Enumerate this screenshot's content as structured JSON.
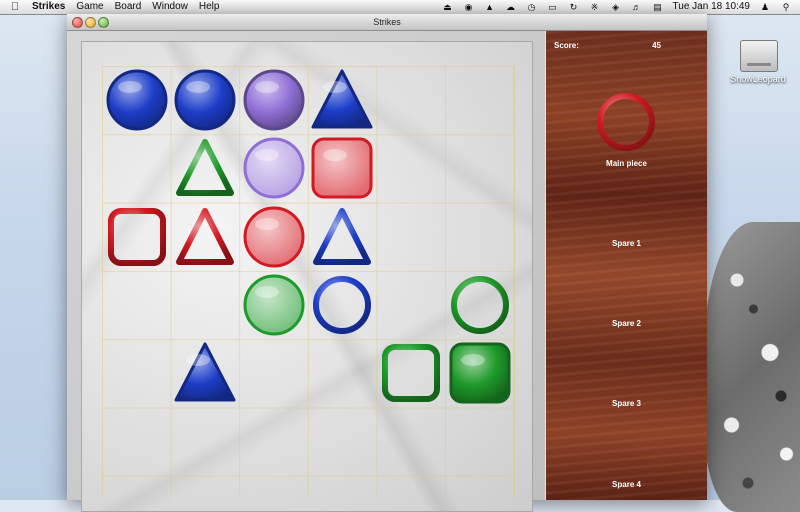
{
  "menubar": {
    "app_name": "Strikes",
    "items": [
      "Game",
      "Board",
      "Window",
      "Help"
    ],
    "clock": "Tue Jan 18  10:49"
  },
  "desktop": {
    "drive_label": "SnowLeopard"
  },
  "window": {
    "title": "Strikes"
  },
  "panel": {
    "score_label": "Score:",
    "score_value": "45",
    "main_piece_label": "Main piece",
    "spare_labels": [
      "Spare 1",
      "Spare 2",
      "Spare 3",
      "Spare 4"
    ]
  },
  "colors": {
    "red": "#d21a22",
    "green": "#1e9a2a",
    "blue": "#1d3ec9",
    "purple": "#8f6fd6"
  },
  "board": {
    "rows": 6,
    "cols": 6,
    "pieces": [
      {
        "row": 0,
        "col": 0,
        "shape": "circle",
        "style": "filled",
        "color": "blue"
      },
      {
        "row": 0,
        "col": 1,
        "shape": "circle",
        "style": "filled",
        "color": "blue"
      },
      {
        "row": 0,
        "col": 2,
        "shape": "circle",
        "style": "filled",
        "color": "purple"
      },
      {
        "row": 0,
        "col": 3,
        "shape": "triangle",
        "style": "filled",
        "color": "blue"
      },
      {
        "row": 1,
        "col": 1,
        "shape": "triangle",
        "style": "outline",
        "color": "green"
      },
      {
        "row": 1,
        "col": 2,
        "shape": "circle",
        "style": "light",
        "color": "purple"
      },
      {
        "row": 1,
        "col": 3,
        "shape": "square",
        "style": "light",
        "color": "red"
      },
      {
        "row": 2,
        "col": 0,
        "shape": "square",
        "style": "outline",
        "color": "red"
      },
      {
        "row": 2,
        "col": 1,
        "shape": "triangle",
        "style": "outline",
        "color": "red"
      },
      {
        "row": 2,
        "col": 2,
        "shape": "circle",
        "style": "light",
        "color": "red"
      },
      {
        "row": 2,
        "col": 3,
        "shape": "triangle",
        "style": "outline",
        "color": "blue"
      },
      {
        "row": 3,
        "col": 2,
        "shape": "circle",
        "style": "light",
        "color": "green"
      },
      {
        "row": 3,
        "col": 3,
        "shape": "circle",
        "style": "outline",
        "color": "blue"
      },
      {
        "row": 3,
        "col": 5,
        "shape": "circle",
        "style": "outline",
        "color": "green"
      },
      {
        "row": 4,
        "col": 1,
        "shape": "triangle",
        "style": "filled",
        "color": "blue"
      },
      {
        "row": 4,
        "col": 4,
        "shape": "square",
        "style": "outline",
        "color": "green"
      },
      {
        "row": 4,
        "col": 5,
        "shape": "square",
        "style": "filled",
        "color": "green"
      }
    ],
    "main_piece": {
      "shape": "circle",
      "style": "outline",
      "color": "red"
    }
  }
}
